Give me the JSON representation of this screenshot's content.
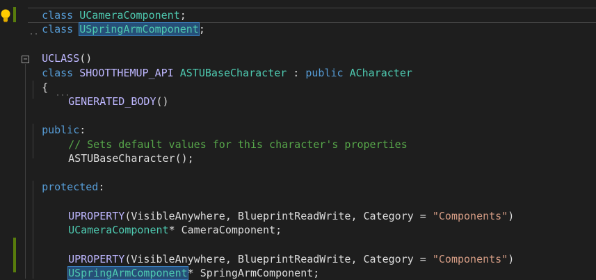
{
  "editor": {
    "lines": {
      "l1": {
        "kw": "class",
        "type": "UCameraComponent",
        "rest": ";"
      },
      "l2": {
        "kw": "class",
        "type": "USpringArmComponent",
        "rest": ";"
      },
      "l3": {
        "macro": "UCLASS",
        "rest": "()"
      },
      "l4": {
        "kw": "class",
        "macro": "SHOOTTHEMUP_API",
        "type": "ASTUBaseCharacter",
        "sep": " : ",
        "kw2": "public",
        "type2": "ACharacter"
      },
      "l5": {
        "text": "{"
      },
      "l6": {
        "macro": "GENERATED_BODY",
        "rest": "()"
      },
      "l7": {
        "kw": "public",
        "rest": ":"
      },
      "l8": {
        "comment": "// Sets default values for this character's properties"
      },
      "l9": {
        "text": "ASTUBaseCharacter();"
      },
      "l10": {
        "kw": "protected",
        "rest": ":"
      },
      "l11": {
        "macro": "UPROPERTY",
        "args": "(VisibleAnywhere, BlueprintReadWrite, Category = ",
        "str": "\"Components\"",
        "close": ")"
      },
      "l12": {
        "type": "UCameraComponent",
        "rest": "* CameraComponent;"
      },
      "l13": {
        "macro": "UPROPERTY",
        "args": "(VisibleAnywhere, BlueprintReadWrite, Category = ",
        "str": "\"Components\"",
        "close": ")"
      },
      "l14": {
        "type": "USpringArmComponent",
        "rest": "* SpringArmComponent;"
      }
    },
    "collapse_glyph": "−",
    "lightbulb_icon": "lightbulb-icon"
  }
}
